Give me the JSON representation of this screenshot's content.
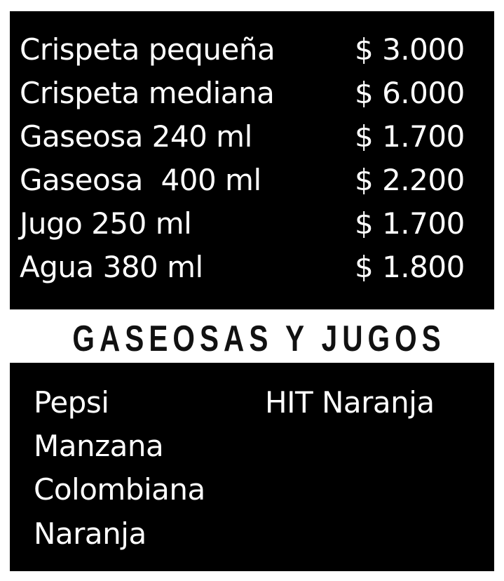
{
  "price_list": [
    {
      "name": "Crispeta pequeña",
      "price": "$ 3.000"
    },
    {
      "name": "Crispeta mediana",
      "price": "$ 6.000"
    },
    {
      "name": "Gaseosa 240 ml",
      "price": "$ 1.700"
    },
    {
      "name": "Gaseosa  400 ml",
      "price": "$ 2.200"
    },
    {
      "name": "Jugo 250 ml",
      "price": "$ 1.700"
    },
    {
      "name": "Agua 380 ml",
      "price": "$ 1.800"
    }
  ],
  "section_title": "GASEOSAS Y JUGOS",
  "flavors_left": [
    "Pepsi",
    "Manzana",
    "Colombiana",
    "Naranja"
  ],
  "flavors_right": [
    "HIT Naranja"
  ],
  "colors": {
    "panel_background": "#000000",
    "panel_text": "#ffffff",
    "page_background": "#ffffff",
    "title_text": "#111111"
  }
}
